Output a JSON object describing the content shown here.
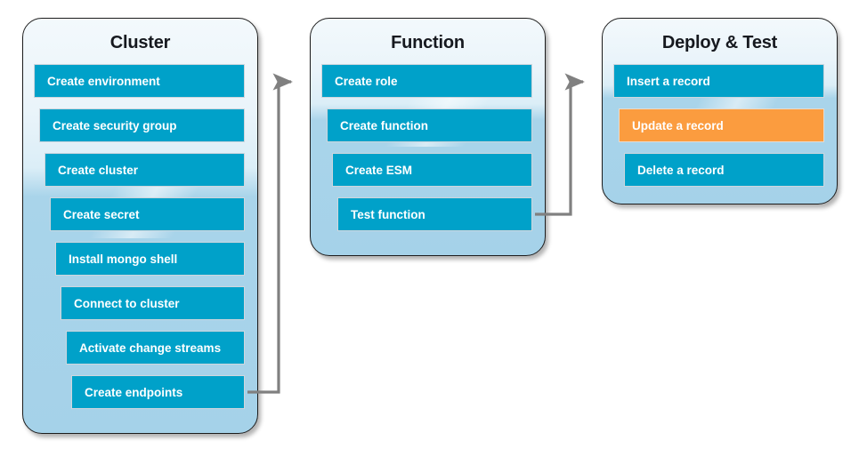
{
  "diagram": {
    "title_color": "#16191f",
    "accent_blue": "#00a1c9",
    "accent_orange": "#fb9c3f",
    "connector_color": "#808080",
    "panel_fill_top": "#f3f9fc",
    "panel_fill_bottom": "#a5d2e9",
    "phases": [
      {
        "id": "cluster",
        "title": "Cluster",
        "steps": [
          {
            "label": "Create environment",
            "state": "normal"
          },
          {
            "label": "Create security group",
            "state": "normal"
          },
          {
            "label": "Create cluster",
            "state": "normal"
          },
          {
            "label": "Create secret",
            "state": "normal"
          },
          {
            "label": "Install mongo shell",
            "state": "normal"
          },
          {
            "label": "Connect to cluster",
            "state": "normal"
          },
          {
            "label": "Activate change streams",
            "state": "normal"
          },
          {
            "label": "Create endpoints",
            "state": "normal"
          }
        ]
      },
      {
        "id": "function",
        "title": "Function",
        "steps": [
          {
            "label": "Create role",
            "state": "normal"
          },
          {
            "label": "Create function",
            "state": "normal"
          },
          {
            "label": "Create ESM",
            "state": "normal"
          },
          {
            "label": "Test function",
            "state": "normal"
          }
        ]
      },
      {
        "id": "deploy",
        "title": "Deploy & Test",
        "steps": [
          {
            "label": "Insert a record",
            "state": "normal"
          },
          {
            "label": "Update a record",
            "state": "highlight"
          },
          {
            "label": "Delete a record",
            "state": "normal"
          }
        ]
      }
    ],
    "connectors": [
      {
        "id": "cluster-to-function",
        "from": "Create endpoints",
        "to": "Create role"
      },
      {
        "id": "function-to-deploy",
        "from": "Test function",
        "to": "Insert a record"
      }
    ]
  }
}
